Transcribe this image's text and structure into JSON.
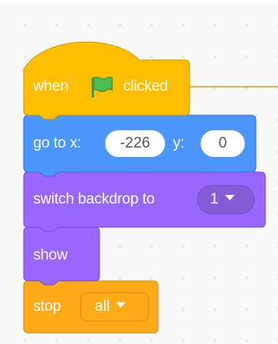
{
  "script": {
    "hat_block": {
      "prefix": "when",
      "icon": "green-flag-icon",
      "suffix": "clicked",
      "color": "#FFBF00"
    },
    "goto_block": {
      "label_x": "go to x:",
      "x_value": "-226",
      "label_y": "y:",
      "y_value": "0",
      "color": "#4C97FF"
    },
    "backdrop_block": {
      "label": "switch backdrop to",
      "selected": "1",
      "color": "#9966FF"
    },
    "show_block": {
      "label": "show",
      "color": "#9966FF"
    },
    "stop_block": {
      "label": "stop",
      "selected": "all",
      "color": "#FFAB19"
    }
  }
}
